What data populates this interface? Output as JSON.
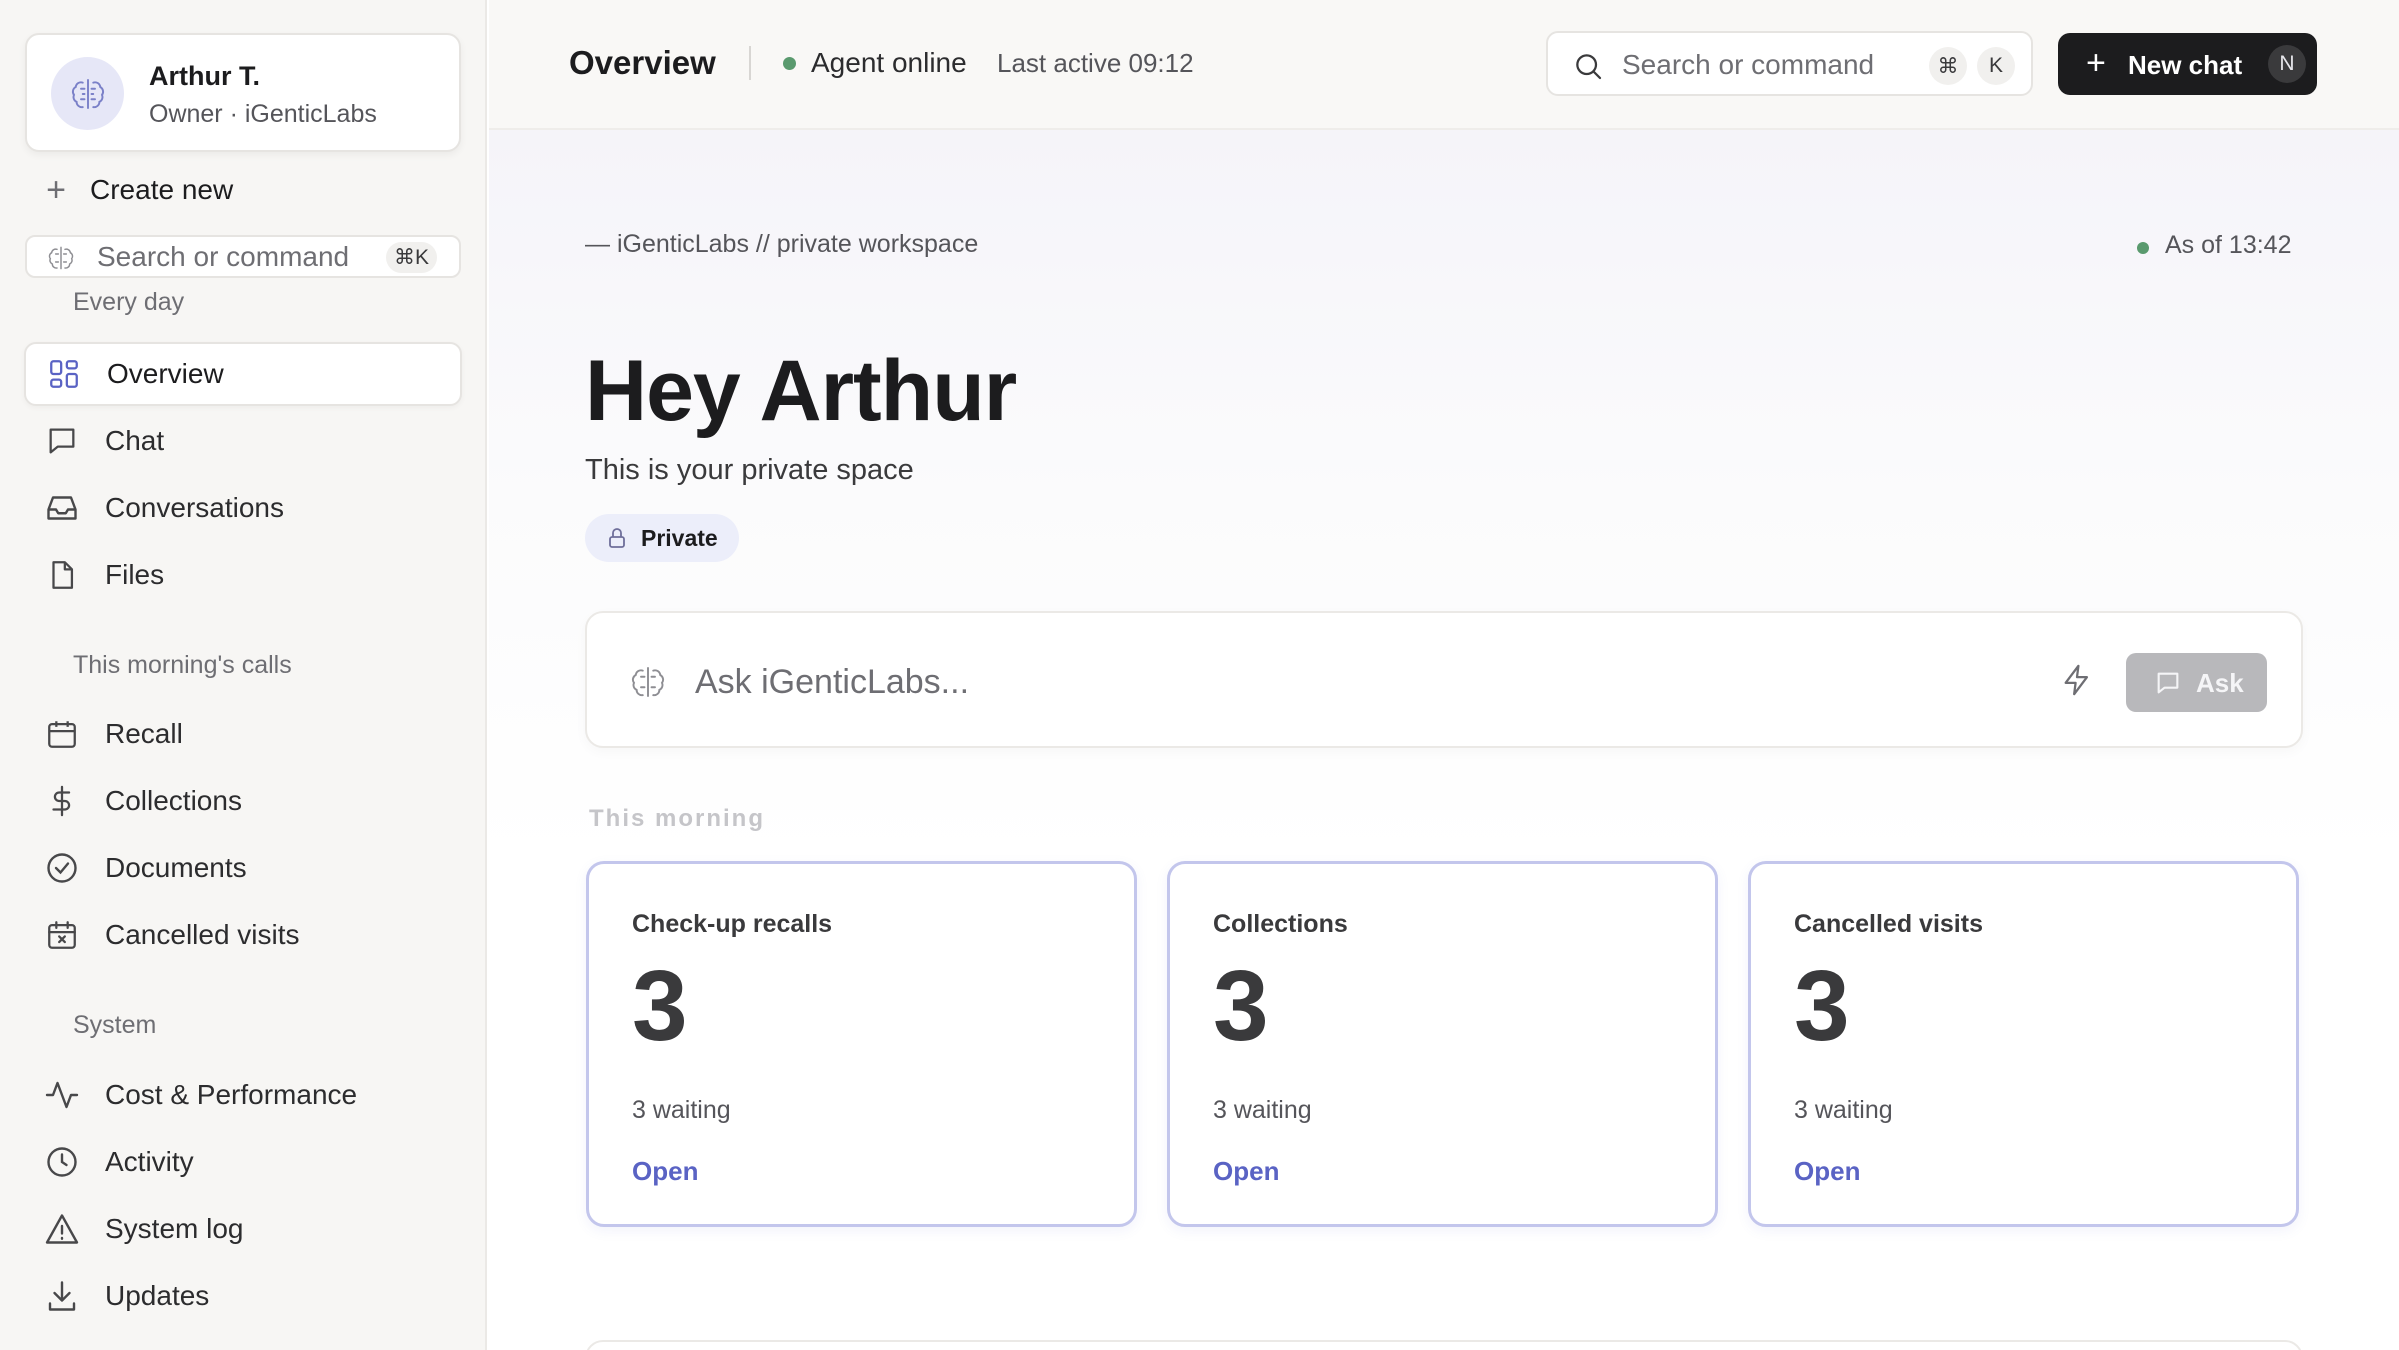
{
  "user": {
    "name": "Arthur T.",
    "role": "Owner · iGenticLabs"
  },
  "sidebar": {
    "create_new": "Create new",
    "search_placeholder": "Search or command",
    "search_shortcut": "⌘K",
    "every_day_label": "Every day",
    "every_day": [
      {
        "label": "Overview",
        "icon": "grid-icon",
        "active": true
      },
      {
        "label": "Chat",
        "icon": "chat-bubble-icon"
      },
      {
        "label": "Conversations",
        "icon": "inbox-icon"
      },
      {
        "label": "Files",
        "icon": "file-icon"
      }
    ],
    "calls_label": "This morning's calls",
    "calls": [
      {
        "label": "Recall",
        "icon": "calendar-icon"
      },
      {
        "label": "Collections",
        "icon": "dollar-icon"
      },
      {
        "label": "Documents",
        "icon": "check-circle-icon"
      },
      {
        "label": "Cancelled visits",
        "icon": "calendar-x-icon"
      }
    ],
    "system_label": "System",
    "system": [
      {
        "label": "Cost & Performance",
        "icon": "pulse-icon"
      },
      {
        "label": "Activity",
        "icon": "clock-icon"
      },
      {
        "label": "System log",
        "icon": "warning-icon"
      },
      {
        "label": "Updates",
        "icon": "download-icon"
      }
    ]
  },
  "topbar": {
    "title": "Overview",
    "status": "Agent online",
    "last_active": "Last active 09:12",
    "search_placeholder": "Search or command",
    "search_key_1": "⌘",
    "search_key_2": "K",
    "new_chat_label": "New chat",
    "new_chat_key": "N"
  },
  "main": {
    "breadcrumb": "— iGenticLabs // private workspace",
    "as_of": "As of 13:42",
    "greeting": "Hey Arthur",
    "subtitle": "This is your private space",
    "private_badge": "Private",
    "ask_placeholder": "Ask iGenticLabs...",
    "ask_button": "Ask",
    "section_title": "This morning",
    "cards": [
      {
        "title": "Check-up recalls",
        "count": "3",
        "sub": "3 waiting",
        "action": "Open"
      },
      {
        "title": "Collections",
        "count": "3",
        "sub": "3 waiting",
        "action": "Open"
      },
      {
        "title": "Cancelled visits",
        "count": "3",
        "sub": "3 waiting",
        "action": "Open"
      }
    ]
  },
  "colors": {
    "accent": "#5a63c4",
    "card_border": "#c3c6ec",
    "status_green": "#5a9a6e",
    "primary_button": "#1c1c1e"
  }
}
